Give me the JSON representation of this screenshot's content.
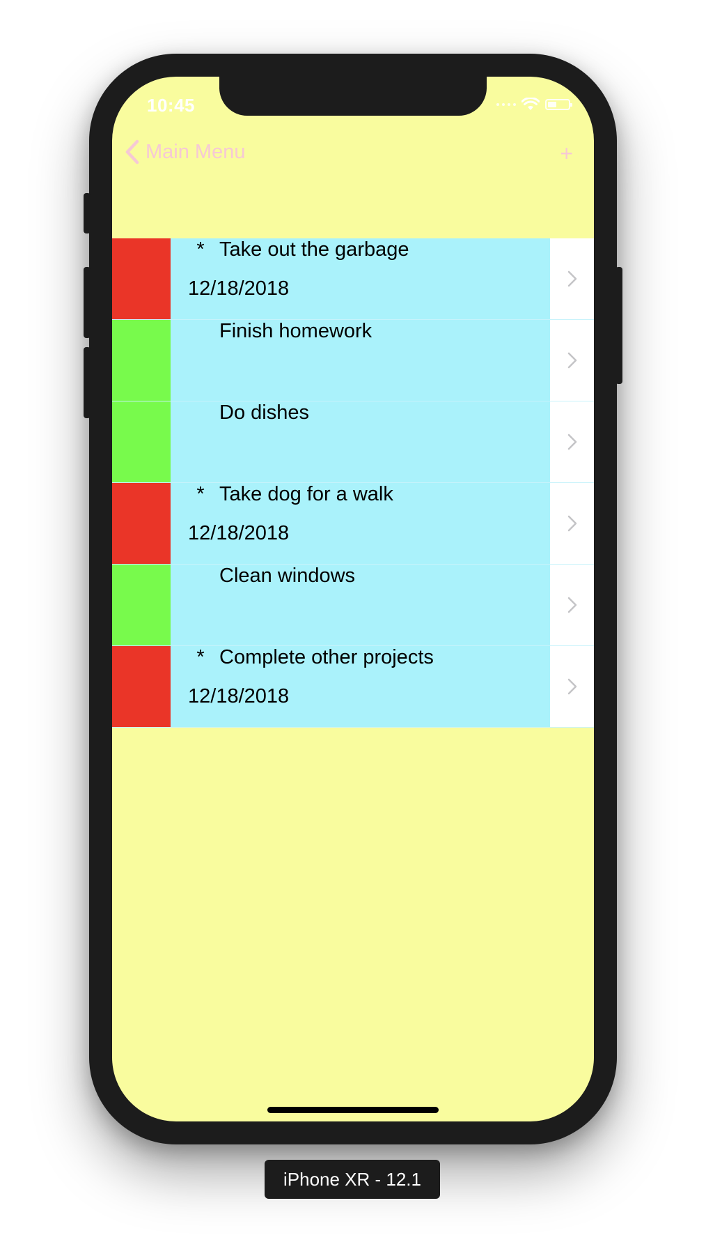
{
  "status_bar": {
    "time": "10:45"
  },
  "nav": {
    "back_label": "Main Menu",
    "add_label": "+"
  },
  "colors": {
    "background": "#f9fc9e",
    "cell_content": "#aaf2fb",
    "priority_high": "#ea3528",
    "priority_low": "#78fa4c",
    "nav_tint": "#f6c9d5"
  },
  "tasks": [
    {
      "marker": "*",
      "title": "Take out the garbage",
      "date": "12/18/2018",
      "priority": "high"
    },
    {
      "marker": "",
      "title": "Finish homework",
      "date": "",
      "priority": "low"
    },
    {
      "marker": "",
      "title": "Do dishes",
      "date": "",
      "priority": "low"
    },
    {
      "marker": "*",
      "title": "Take dog for a walk",
      "date": "12/18/2018",
      "priority": "high"
    },
    {
      "marker": "",
      "title": "Clean windows",
      "date": "",
      "priority": "low"
    },
    {
      "marker": "*",
      "title": "Complete other projects",
      "date": "12/18/2018",
      "priority": "high"
    }
  ],
  "device_label": "iPhone XR - 12.1"
}
